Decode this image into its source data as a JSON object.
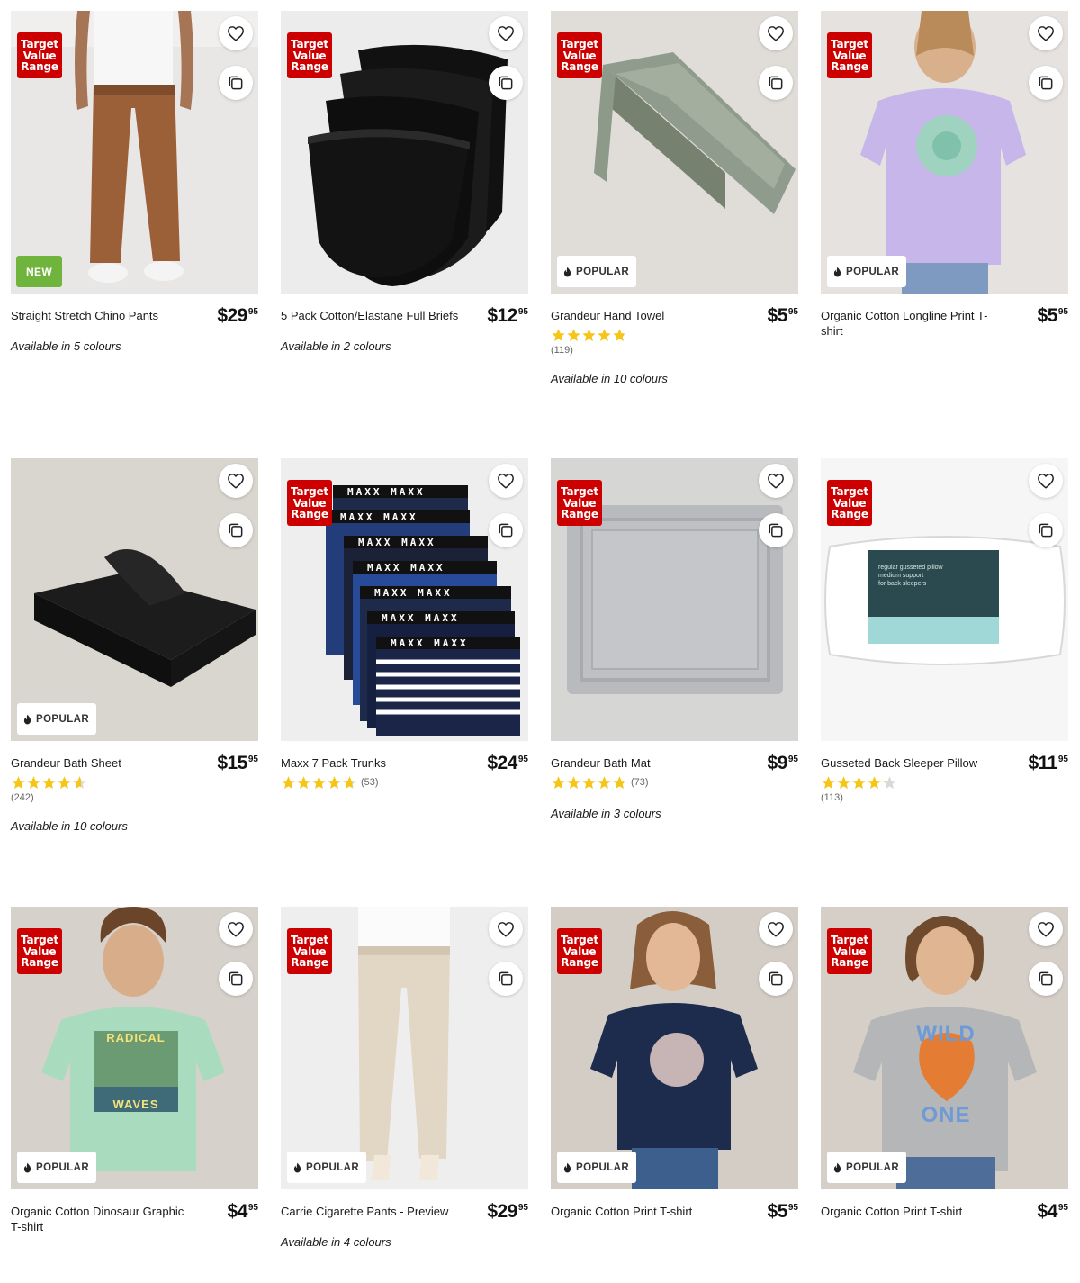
{
  "products": [
    {
      "name": "Straight Stretch Chino Pants",
      "dollars": "$29",
      "cents": "95",
      "tag": "Target Value Range",
      "badge": "NEW",
      "rating": null,
      "reviews": null,
      "colours": "Available in 5 colours"
    },
    {
      "name": "5 Pack Cotton/Elastane Full Briefs",
      "dollars": "$12",
      "cents": "95",
      "tag": "Target Value Range",
      "badge": null,
      "rating": null,
      "reviews": null,
      "colours": "Available in 2 colours"
    },
    {
      "name": "Grandeur Hand Towel",
      "dollars": "$5",
      "cents": "95",
      "tag": "Target Value Range",
      "badge": "POPULAR",
      "rating": 4.8,
      "reviews": "(119)",
      "colours": "Available in 10 colours"
    },
    {
      "name": "Organic Cotton Longline Print T-shirt",
      "dollars": "$5",
      "cents": "95",
      "tag": "Target Value Range",
      "badge": "POPULAR",
      "rating": null,
      "reviews": null,
      "colours": null
    },
    {
      "name": "Grandeur Bath Sheet",
      "dollars": "$15",
      "cents": "95",
      "tag": null,
      "badge": "POPULAR",
      "rating": 4.6,
      "reviews": "(242)",
      "colours": "Available in 10 colours"
    },
    {
      "name": "Maxx 7 Pack Trunks",
      "dollars": "$24",
      "cents": "95",
      "tag": "Target Value Range",
      "badge": null,
      "rating": 4.7,
      "reviews": "(53)",
      "colours": null
    },
    {
      "name": "Grandeur Bath Mat",
      "dollars": "$9",
      "cents": "95",
      "tag": "Target Value Range",
      "badge": null,
      "rating": 4.8,
      "reviews": "(73)",
      "colours": "Available in 3 colours"
    },
    {
      "name": "Gusseted Back Sleeper Pillow",
      "dollars": "$11",
      "cents": "95",
      "tag": "Target Value Range",
      "badge": null,
      "rating": 4.2,
      "reviews": "(113)",
      "colours": null
    },
    {
      "name": "Organic Cotton Dinosaur Graphic T-shirt",
      "dollars": "$4",
      "cents": "95",
      "tag": "Target Value Range",
      "badge": "POPULAR",
      "rating": null,
      "reviews": null,
      "colours": null
    },
    {
      "name": "Carrie Cigarette Pants - Preview",
      "dollars": "$29",
      "cents": "95",
      "tag": "Target Value Range",
      "badge": "POPULAR",
      "rating": null,
      "reviews": null,
      "colours": "Available in 4 colours"
    },
    {
      "name": "Organic Cotton Print T-shirt",
      "dollars": "$5",
      "cents": "95",
      "tag": "Target Value Range",
      "badge": "POPULAR",
      "rating": null,
      "reviews": null,
      "colours": null
    },
    {
      "name": "Organic Cotton Print T-shirt",
      "dollars": "$4",
      "cents": "95",
      "tag": "Target Value Range",
      "badge": "POPULAR",
      "rating": null,
      "reviews": null,
      "colours": null
    }
  ],
  "image_text": {
    "trunks_waistband": "MAXX",
    "pillow_label_1": "regular gusseted pillow",
    "pillow_label_2": "medium support",
    "pillow_label_3": "for back sleepers",
    "dino_tee_text_1": "RADICAL",
    "dino_tee_text_2": "WAVES",
    "tiger_tee_text_1": "WILD",
    "tiger_tee_text_2": "ONE"
  },
  "colors": {
    "tag_red": "#cc0000",
    "new_green": "#6fb43c",
    "star_yellow": "#f5c518",
    "star_empty": "#d9d9d9"
  },
  "icons": {
    "wishlist": "heart-outline-icon",
    "compare": "compare-icon",
    "popular": "flame-icon",
    "rating": "star-icon"
  }
}
